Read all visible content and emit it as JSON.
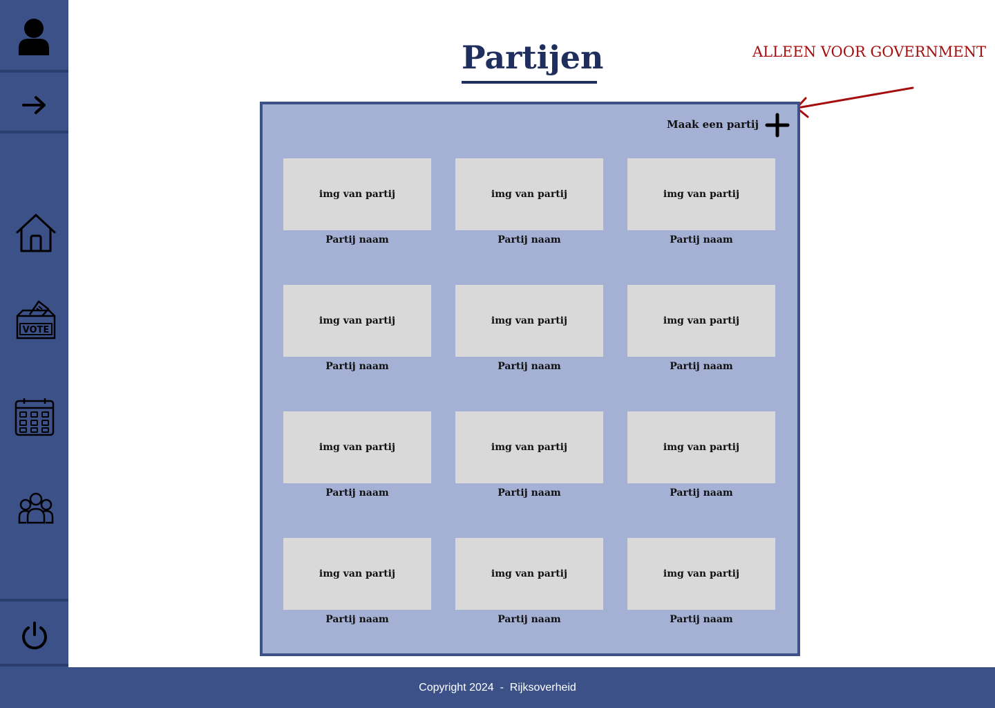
{
  "page": {
    "title": "Partijen",
    "annotation": "ALLEEN VOOR GOVERNMENT"
  },
  "sidebar": {
    "items": [
      {
        "icon": "user-icon"
      },
      {
        "icon": "arrow-right-icon"
      },
      {
        "icon": "home-icon"
      },
      {
        "icon": "vote-box-icon"
      },
      {
        "icon": "calendar-icon"
      },
      {
        "icon": "group-icon"
      },
      {
        "icon": "power-icon"
      }
    ]
  },
  "panel": {
    "create_label": "Maak een partij",
    "create_icon": "plus-icon",
    "cards": [
      {
        "img": "img van partij",
        "name": "Partij naam"
      },
      {
        "img": "img van partij",
        "name": "Partij naam"
      },
      {
        "img": "img van partij",
        "name": "Partij naam"
      },
      {
        "img": "img van partij",
        "name": "Partij naam"
      },
      {
        "img": "img van partij",
        "name": "Partij naam"
      },
      {
        "img": "img van partij",
        "name": "Partij naam"
      },
      {
        "img": "img van partij",
        "name": "Partij naam"
      },
      {
        "img": "img van partij",
        "name": "Partij naam"
      },
      {
        "img": "img van partij",
        "name": "Partij naam"
      },
      {
        "img": "img van partij",
        "name": "Partij naam"
      },
      {
        "img": "img van partij",
        "name": "Partij naam"
      },
      {
        "img": "img van partij",
        "name": "Partij naam"
      }
    ]
  },
  "footer": {
    "text": "Copyright 2024  -  Rijksoverheid"
  },
  "colors": {
    "brand": "#3c5188",
    "panel": "#a4b1d4",
    "title": "#1f2e5c",
    "annotation": "#a60d0d",
    "card": "#d9d9d9"
  }
}
